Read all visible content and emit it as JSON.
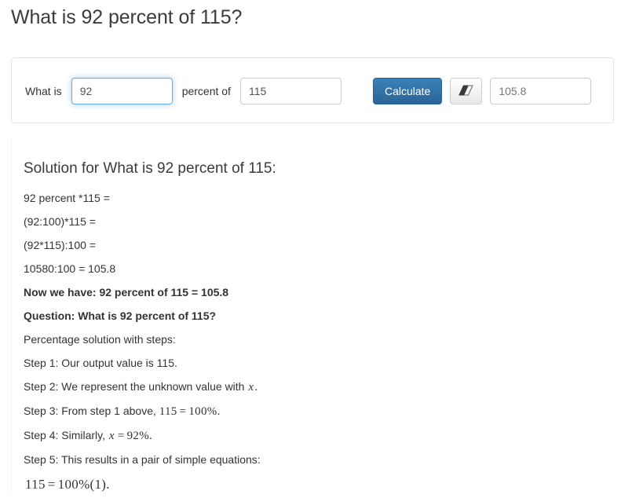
{
  "page": {
    "title": "What is 92 percent of 115?"
  },
  "calculator": {
    "label_what_is": "What is",
    "percent_input": {
      "value": "92",
      "placeholder": ""
    },
    "label_percent_of": "percent of",
    "base_input": {
      "value": "115",
      "placeholder": ""
    },
    "calculate_button": "Calculate",
    "reset_button_icon": "eraser-icon",
    "result_input": {
      "value": "105.8",
      "placeholder": ""
    }
  },
  "solution": {
    "heading": "Solution for What is 92 percent of 115:",
    "lines": [
      "92 percent *115 =",
      "(92:100)*115 =",
      "(92*115):100 =",
      "10580:100 = 105.8"
    ],
    "now_we_have": "Now we have: 92 percent of 115 = 105.8",
    "question": "Question: What is 92 percent of 115?",
    "percentage_intro": "Percentage solution with steps:",
    "step1": {
      "text": "Step 1: Our output value is 115."
    },
    "step2": {
      "prefix": "Step 2: We represent the unknown value with",
      "math_var": "x",
      "suffix": "."
    },
    "step3": {
      "prefix": "Step 3: From step 1 above,",
      "math_left": "115",
      "math_op": "=",
      "math_right": "100%",
      "suffix": "."
    },
    "step4": {
      "prefix": "Step 4: Similarly,",
      "math_left": "x",
      "math_op": "=",
      "math_right": "92%",
      "suffix": "."
    },
    "step5": {
      "text": "Step 5: This results in a pair of simple equations:"
    },
    "equation1": {
      "left": "115",
      "op": "=",
      "right": "100%(1)",
      "suffix": "."
    }
  },
  "colors": {
    "primary_button": "#2d6ca2",
    "focus_border": "#66afe9",
    "text": "#333333",
    "panel_border": "#e3e3e3"
  }
}
